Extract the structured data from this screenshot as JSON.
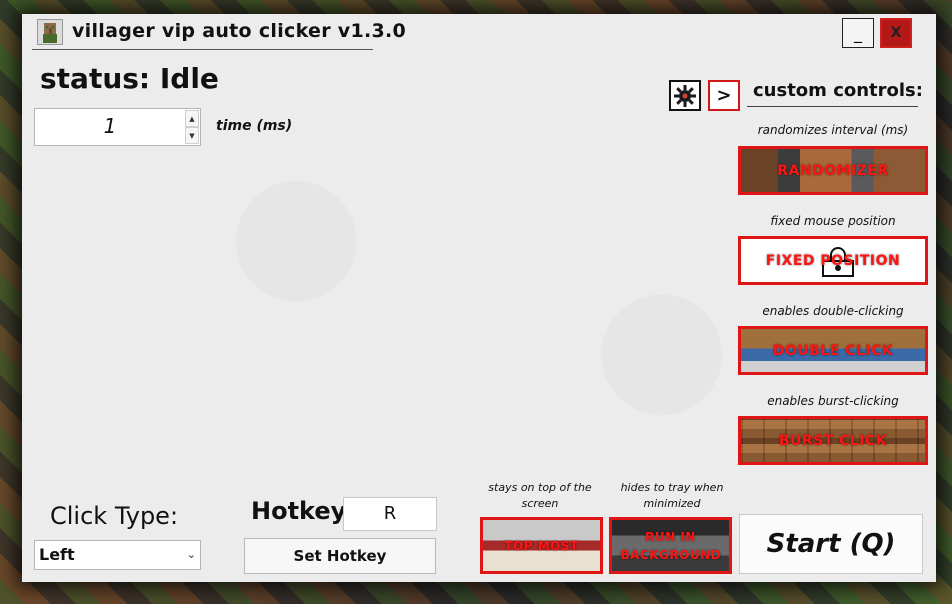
{
  "window": {
    "title": "villager vip auto clicker v1.3.0",
    "minimize_label": "_",
    "close_label": "X"
  },
  "status": {
    "text": "status: Idle"
  },
  "interval": {
    "value": "1",
    "label": "time (ms)",
    "up_glyph": "▲",
    "down_glyph": "▼"
  },
  "custom_controls": {
    "title": "custom controls:",
    "arrow_label": ">",
    "items": [
      {
        "caption": "randomizes interval (ms)",
        "label": "RANDOMIZER"
      },
      {
        "caption": "fixed mouse position",
        "label": "FIXED POSITION"
      },
      {
        "caption": "enables double-clicking",
        "label": "DOUBLE CLICK"
      },
      {
        "caption": "enables burst-clicking",
        "label": "BURST CLICK"
      }
    ]
  },
  "click_type": {
    "label": "Click Type:",
    "selected": "Left",
    "chevron": "⌄"
  },
  "hotkey": {
    "label": "Hotkey:",
    "value": "R",
    "set_label": "Set Hotkey"
  },
  "extras": {
    "top_most": {
      "caption": "stays on top of the screen",
      "label": "TOP MOST"
    },
    "background": {
      "caption": "hides to tray when minimized",
      "label": "RUN IN BACKGROUND"
    }
  },
  "start": {
    "label": "Start (Q)"
  },
  "colors": {
    "accent_red": "#e01616",
    "text_red": "#ff1414",
    "window_bg": "#ececec"
  },
  "icons": {
    "title_icon": "villager-icon",
    "gear": "gear-icon",
    "lock": "lock-icon"
  }
}
